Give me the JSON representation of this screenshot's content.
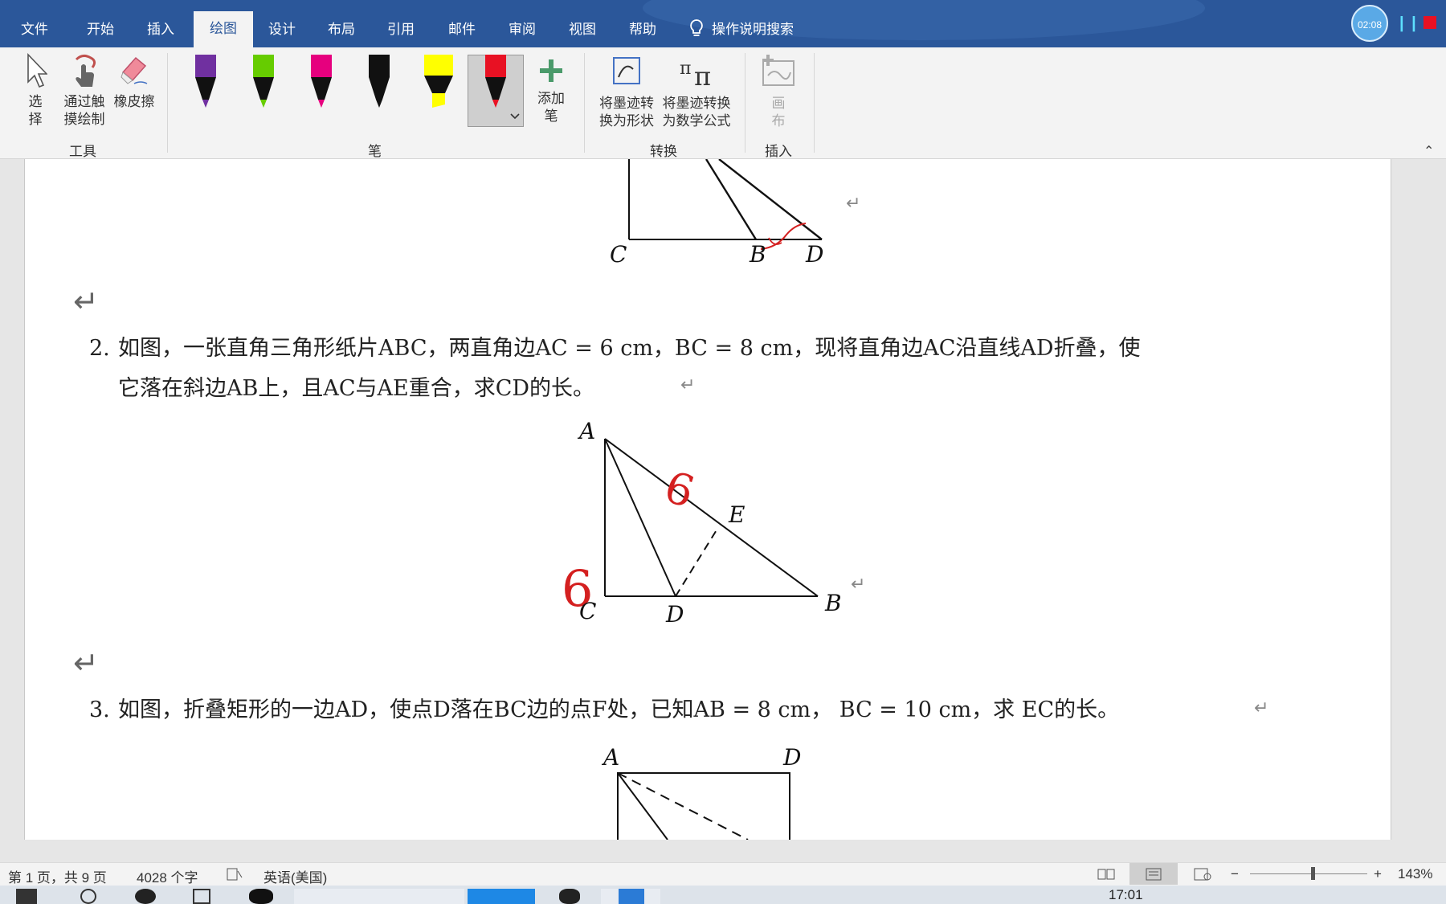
{
  "tabs": [
    {
      "label": "文件"
    },
    {
      "label": "开始"
    },
    {
      "label": "插入"
    },
    {
      "label": "绘图"
    },
    {
      "label": "设计"
    },
    {
      "label": "布局"
    },
    {
      "label": "引用"
    },
    {
      "label": "邮件"
    },
    {
      "label": "审阅"
    },
    {
      "label": "视图"
    },
    {
      "label": "帮助"
    }
  ],
  "tell_me": "操作说明搜索",
  "recorder": {
    "time": "02:08"
  },
  "ribbon": {
    "tools": {
      "select_label": "选择",
      "touch_draw_label_1": "通过触",
      "touch_draw_label_2": "摸绘制",
      "eraser_label": "橡皮擦",
      "group_label": "工具"
    },
    "pens": {
      "colors": [
        "#7030a0",
        "#66cc00",
        "#e6007e",
        "#111111",
        "#ffff00",
        "#e81123"
      ],
      "add_pen_label_1": "添加",
      "add_pen_label_2": "笔",
      "group_label": "笔"
    },
    "convert": {
      "to_shape_label_1": "将墨迹转",
      "to_shape_label_2": "换为形状",
      "to_math_label_1": "将墨迹转换",
      "to_math_label_2": "为数学公式",
      "group_label": "转换"
    },
    "insert": {
      "canvas_label_1": "画",
      "canvas_label_2": "布",
      "group_label": "插入"
    }
  },
  "document": {
    "fig1_labels": {
      "c": "C",
      "b": "B",
      "d": "D"
    },
    "q2": {
      "number": "2.",
      "line1": "如图，一张直角三角形纸片ABC，两直角边AC = 6 cm，BC = 8 cm，现将直角边AC沿直线AD折叠，使",
      "line2": "它落在斜边AB上，且AC与AE重合，求CD的长。"
    },
    "fig2_labels": {
      "a": "A",
      "e": "E",
      "c": "C",
      "d": "D",
      "b": "B"
    },
    "fig2_ink": {
      "left": "6",
      "hyp": "6"
    },
    "q3": {
      "number": "3.",
      "line1": "如图，折叠矩形的一边AD，使点D落在BC边的点F处，已知AB = 8 cm， BC = 10 cm，求 EC的长。"
    },
    "fig3_labels": {
      "a": "A",
      "d": "D"
    },
    "return_mark": "↵"
  },
  "status": {
    "page_info": "第 1 页，共 9 页",
    "word_count": "4028 个字",
    "language": "英语(美国)",
    "zoom": "143%"
  },
  "taskbar": {
    "time": "17:01"
  }
}
